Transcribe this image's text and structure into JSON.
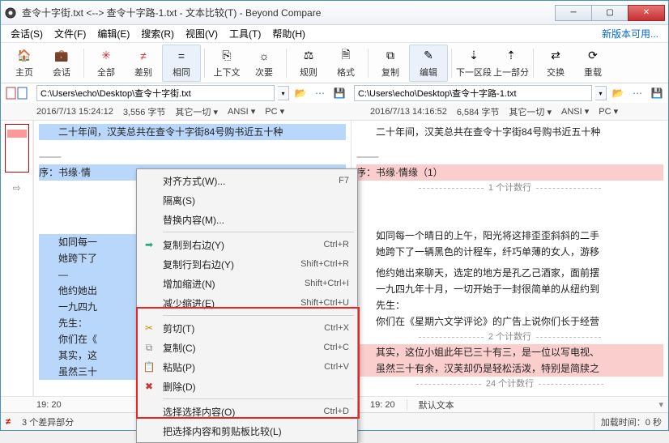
{
  "title": "查令十字街.txt <--> 查令十字路-1.txt - 文本比较(T) - Beyond Compare",
  "new_version": "新版本可用...",
  "menubar": {
    "session": "会话(S)",
    "file": "文件(F)",
    "edit": "编辑(E)",
    "search": "搜索(R)",
    "view": "视图(V)",
    "tools": "工具(T)",
    "help": "帮助(H)"
  },
  "toolbar": {
    "home": "主页",
    "session": "会话",
    "all": "全部",
    "diff": "差别",
    "same": "相同",
    "context": "上下文",
    "minor": "次要",
    "rules": "规则",
    "format": "格式",
    "copy": "复制",
    "edit": "编辑",
    "next_section": "下一区段",
    "prev_section": "上一部分",
    "swap": "交换",
    "reload": "重载"
  },
  "left": {
    "path": "C:\\Users\\echo\\Desktop\\查令十字街.txt",
    "ts": "2016/7/13 15:24:12",
    "size": "3,556 字节",
    "else": "其它一切",
    "enc": "ANSI",
    "plat": "PC",
    "pos": "19: 20",
    "lines": {
      "l1": "　　二十年间，汉芙总共在查令十字街84号购书近五十种",
      "dash": "---------",
      "l3": "序：书缘·情",
      "l4": "　　如同每一",
      "l5": "　　她跨下了",
      "l6": "　　—",
      "l7": "　　他约她出",
      "l8": "　　一九四九",
      "l9": "　　先生：",
      "l10": "　　你们在《",
      "l11": "　　其实，这",
      "l12": "　　虽然三十"
    }
  },
  "right": {
    "path": "C:\\Users\\echo\\Desktop\\查令十字路-1.txt",
    "ts": "2016/7/13 14:16:52",
    "size": "6,584 字节",
    "else": "其它一切",
    "enc": "ANSI",
    "plat": "PC",
    "pos": "19: 20",
    "default_text": "默认文本",
    "lines": {
      "r1": "　　二十年间，汉芙总共在查令十字街84号购书近五十种",
      "dash": "---------",
      "r3": "序：书缘·情缘（1）",
      "mark1": "1 个计数行",
      "r4": "　　如同每一个晴日的上午，阳光将这排歪歪斜斜的二手",
      "r5": "　　她跨下了一辆黑色的计程车，纤巧单薄的女人，游移",
      "r6": "　　他约她出来聊天，选定的地方是孔乙己酒家，面前摆",
      "r7": "　　一九四九年十月，一切开始于一封很简单的从纽约到",
      "r8": "　　先生：",
      "r9": "　　你们在《星期六文学评论》的广告上说你们长于经营",
      "mark2": "2 个计数行",
      "r10": "　　其实，这位小姐此年已三十有三，是一位以写电视、",
      "r11": "　　虽然三十有余，汉芙却仍是轻松活泼，特别是简牍之",
      "mark3": "24 个计数行"
    }
  },
  "context_menu": {
    "align": "对齐方式(W)...",
    "align_sc": "F7",
    "isolate": "隔离(S)",
    "replace": "替换内容(M)...",
    "copy_right": "复制到右边(Y)",
    "copy_right_sc": "Ctrl+R",
    "copyline_right": "复制行到右边(Y)",
    "copyline_right_sc": "Shift+Ctrl+R",
    "inc_indent": "增加缩进(N)",
    "inc_indent_sc": "Shift+Ctrl+I",
    "dec_indent": "减少缩进(E)",
    "dec_indent_sc": "Shift+Ctrl+U",
    "cut": "剪切(T)",
    "cut_sc": "Ctrl+X",
    "copy": "复制(C)",
    "copy_sc": "Ctrl+C",
    "paste": "粘贴(P)",
    "paste_sc": "Ctrl+V",
    "delete": "删除(D)",
    "select_sel": "选择选择内容(O)",
    "select_sel_sc": "Ctrl+D",
    "compare_clip": "把选择内容和剪贴板比较(L)"
  },
  "status": {
    "diff_count": "3 个差异部分",
    "load_time": "加载时间：0 秒"
  }
}
